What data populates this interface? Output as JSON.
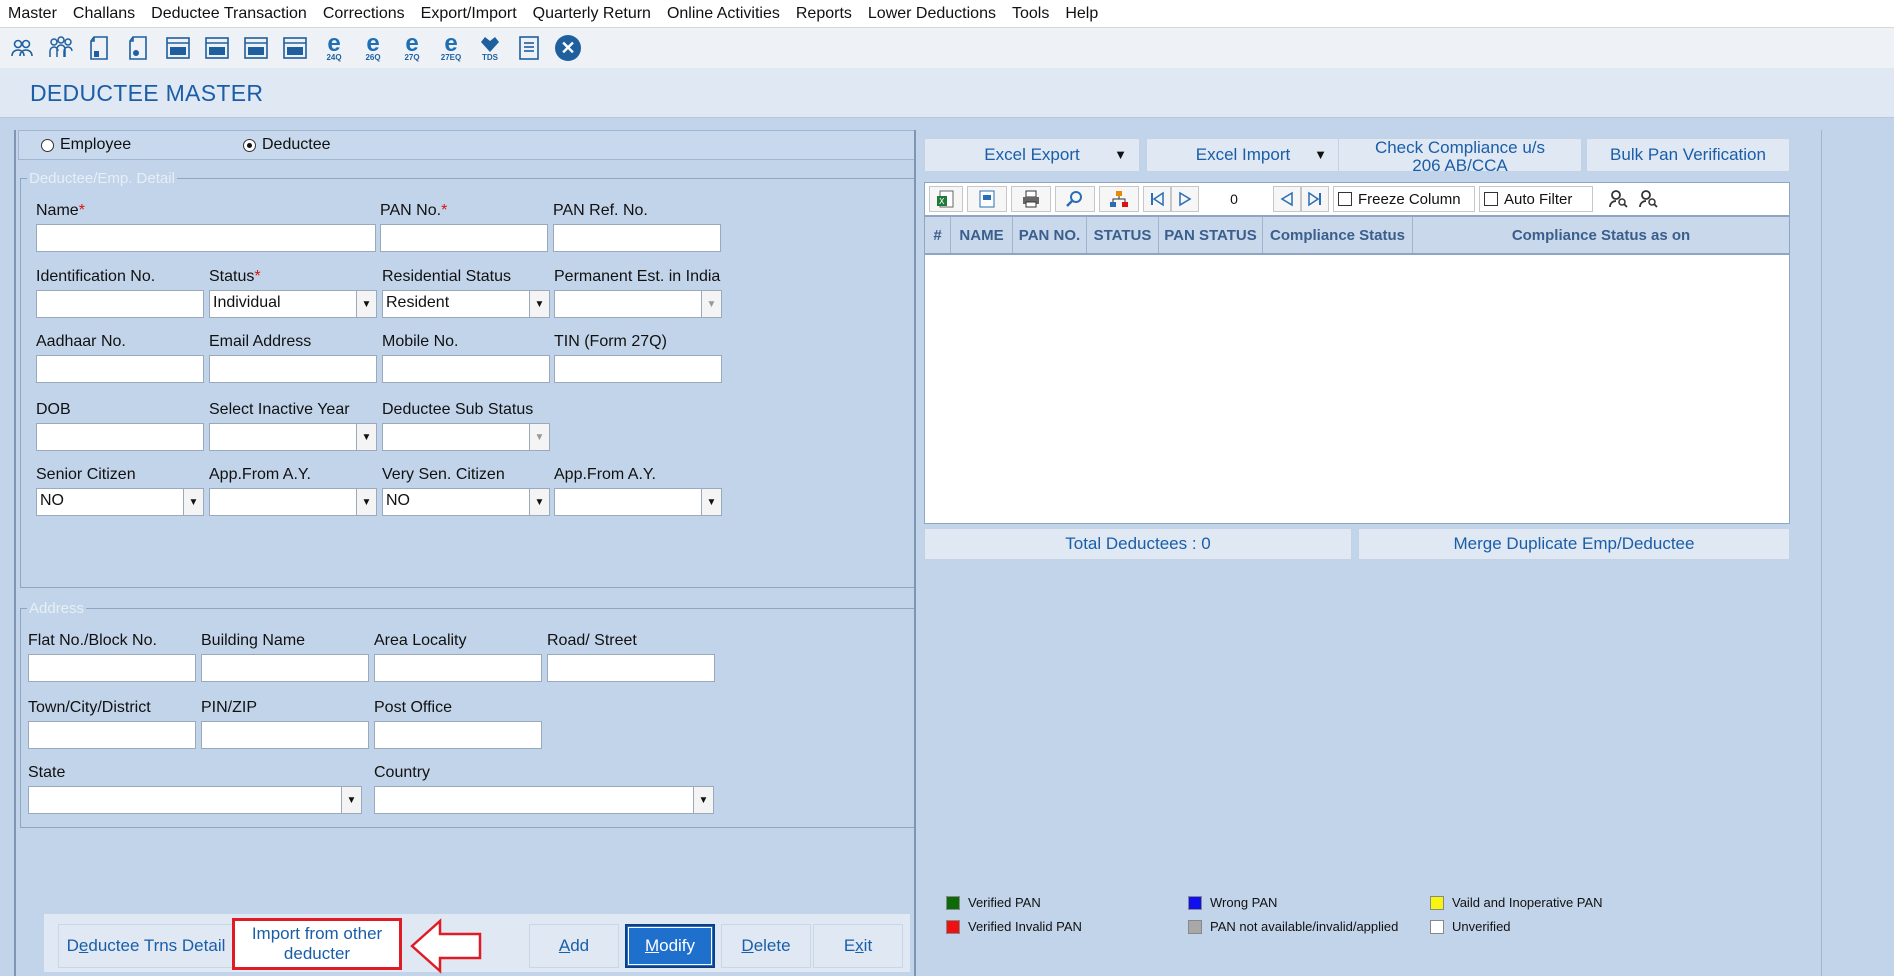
{
  "menu": [
    "Master",
    "Challans",
    "Deductee Transaction",
    "Corrections",
    "Export/Import",
    "Quarterly Return",
    "Online Activities",
    "Reports",
    "Lower Deductions",
    "Tools",
    "Help"
  ],
  "toolbar": {
    "icons": [
      {
        "name": "users-icon",
        "label": ""
      },
      {
        "name": "group-icon",
        "label": ""
      },
      {
        "name": "deductee-form-icon",
        "label": ""
      },
      {
        "name": "employee-form-icon",
        "label": ""
      },
      {
        "name": "form-24q-icon",
        "label": "24Q"
      },
      {
        "name": "form-26q-icon",
        "label": "26Q"
      },
      {
        "name": "form-27q-icon",
        "label": "27Q"
      },
      {
        "name": "form-27eq-icon",
        "label": "27EQ"
      },
      {
        "name": "efile-24q-icon",
        "label": "24Q"
      },
      {
        "name": "efile-26q-icon",
        "label": "26Q"
      },
      {
        "name": "efile-27q-icon",
        "label": "27Q"
      },
      {
        "name": "efile-27eq-icon",
        "label": "27EQ"
      },
      {
        "name": "tds-icon",
        "label": "TDS"
      },
      {
        "name": "report-icon",
        "label": ""
      },
      {
        "name": "close-icon",
        "label": ""
      }
    ],
    "efile_glyph": "e",
    "close_glyph": "✕"
  },
  "title": "DEDUCTEE MASTER",
  "type_selector": {
    "employee": "Employee",
    "deductee": "Deductee",
    "selected": "Deductee"
  },
  "detail_group": {
    "legend": "Deductee/Emp. Detail",
    "name": "Name",
    "pan_no": "PAN No.",
    "pan_ref_no": "PAN Ref. No.",
    "identification_no": "Identification No.",
    "status": "Status",
    "status_value": "Individual",
    "residential_status": "Residential Status",
    "residential_value": "Resident",
    "permanent_est": "Permanent Est. in India",
    "aadhaar_no": "Aadhaar No.",
    "email": "Email Address",
    "mobile": "Mobile No.",
    "tin": "TIN (Form 27Q)",
    "dob": "DOB",
    "inactive_year": "Select Inactive Year",
    "sub_status": "Deductee Sub Status",
    "senior_citizen": "Senior Citizen",
    "senior_value": "NO",
    "app_from_ay": "App.From A.Y.",
    "very_senior": "Very Sen. Citizen",
    "very_senior_value": "NO",
    "app_from_ay2": "App.From A.Y.",
    "required_mark": "*"
  },
  "address_group": {
    "legend": "Address",
    "flat": "Flat No./Block No.",
    "building": "Building Name",
    "area": "Area Locality",
    "road": "Road/ Street",
    "town": "Town/City/District",
    "pin": "PIN/ZIP",
    "post_office": "Post Office",
    "state": "State",
    "country": "Country"
  },
  "buttons": {
    "trns_detail_pre": "D",
    "trns_detail_u": "e",
    "trns_detail_post": "ductee Trns Detail",
    "import_line1": "Import from other",
    "import_line2": "deducter",
    "add_u": "A",
    "add_post": "dd",
    "modify_u": "M",
    "modify_post": "odify",
    "delete_u": "D",
    "delete_post": "elete",
    "exit_pre": "E",
    "exit_u": "x",
    "exit_post": "it"
  },
  "right": {
    "excel_export": "Excel Export",
    "excel_import": "Excel Import",
    "check_compliance": "Check Compliance u/s 206 AB/CCA",
    "bulk_pan": "Bulk Pan Verification",
    "dropdown_glyph": "▼",
    "record_no": "0",
    "freeze_column": "Freeze Column",
    "auto_filter": "Auto Filter",
    "columns": [
      "#",
      "NAME",
      "PAN NO.",
      "STATUS",
      "PAN STATUS",
      "Compliance Status",
      "Compliance Status as on"
    ],
    "total": "Total Deductees : 0",
    "merge": "Merge Duplicate Emp/Deductee"
  },
  "legend": [
    {
      "label": "Verified PAN",
      "color": "#0b6b0b"
    },
    {
      "label": "Verified Invalid PAN",
      "color": "#ee1111"
    },
    {
      "label": "Wrong PAN",
      "color": "#1010ee"
    },
    {
      "label": "PAN not available/invalid/applied",
      "color": "#a8a8a8"
    },
    {
      "label": "Vaild and Inoperative PAN",
      "color": "#f5f511"
    },
    {
      "label": "Unverified",
      "color": "#ffffff"
    }
  ]
}
